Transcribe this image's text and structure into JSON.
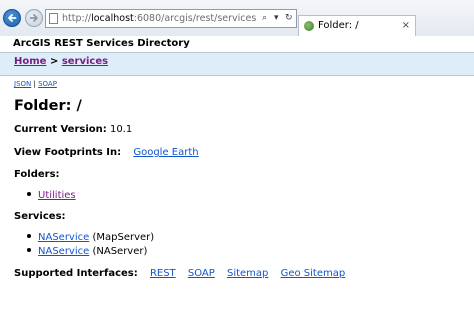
{
  "browser": {
    "address_prefix": "http://",
    "address_host": "localhost",
    "address_rest": ":6080/arcgis/rest/services",
    "search_glyph": "⌕",
    "dropdown_glyph": "▾",
    "refresh_glyph": "↻",
    "tab_title": "Folder: /",
    "tab_close": "×"
  },
  "page": {
    "banner": "ArcGIS REST Services Directory",
    "breadcrumb": {
      "home": "Home",
      "separator": ">",
      "services": "services"
    },
    "formats": {
      "json": "JSON",
      "separator": "|",
      "soap": "SOAP"
    },
    "folder_title": "Folder: /",
    "current_version_label": "Current Version:",
    "current_version_value": "10.1",
    "footprints_label": "View Footprints In:",
    "footprints_link": "Google Earth",
    "folders_label": "Folders:",
    "folders": [
      {
        "name": "Utilities"
      }
    ],
    "services_label": "Services:",
    "services": [
      {
        "name": "NAService",
        "type": "(MapServer)"
      },
      {
        "name": "NAService",
        "type": "(NAServer)"
      }
    ],
    "interfaces_label": "Supported Interfaces:",
    "interfaces": [
      "REST",
      "SOAP",
      "Sitemap",
      "Geo Sitemap"
    ]
  },
  "colors": {
    "link": "#1155cc",
    "visited_link": "#7a1d87",
    "breadcrumb_bar": "#ddeef9"
  },
  "icons": {
    "back": "back-arrow-icon",
    "forward": "forward-arrow-icon",
    "page": "page-icon",
    "tab": "arcgis-globe-icon"
  }
}
